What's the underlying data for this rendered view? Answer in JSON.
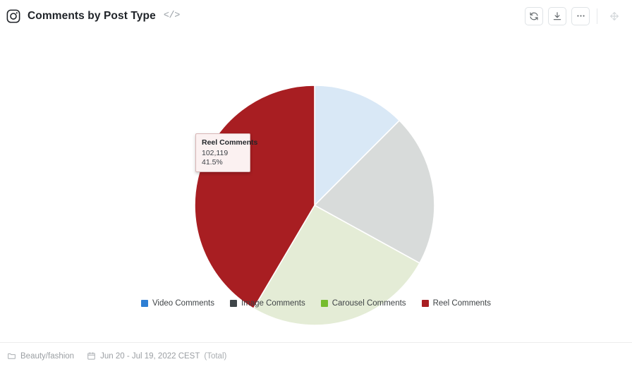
{
  "header": {
    "network_icon": "instagram-icon",
    "title": "Comments by Post Type",
    "code_icon_label": "</>",
    "actions": [
      {
        "name": "refresh-button",
        "icon": "refresh-icon"
      },
      {
        "name": "download-button",
        "icon": "download-icon"
      },
      {
        "name": "more-options-button",
        "icon": "ellipsis-icon"
      }
    ],
    "move_handle_icon": "move-arrows-icon"
  },
  "tooltip": {
    "title": "Reel Comments",
    "value": "102,119",
    "percent": "41.5%"
  },
  "footer": {
    "profile_icon": "folder-icon",
    "profile": "Beauty/fashion",
    "date_icon": "calendar-icon",
    "date_range": "Jun 20 - Jul 19, 2022 CEST",
    "aggregation": "(Total)"
  },
  "chart_data": {
    "type": "pie",
    "title": "Comments by Post Type",
    "categories": [
      "Video Comments",
      "Image Comments",
      "Carousel Comments",
      "Reel Comments"
    ],
    "values": [
      12.5,
      20.5,
      25.5,
      41.5
    ],
    "value_unit": "percent",
    "slice_colors": [
      "#d9e8f6",
      "#d8dbda",
      "#e4ecd6",
      "#a81e22"
    ],
    "legend_colors": [
      "#2e7fd4",
      "#3f4549",
      "#76bc2e",
      "#a81e22"
    ],
    "highlighted": "Reel Comments",
    "highlighted_value": "102,119",
    "highlighted_percent": "41.5%",
    "legend_position": "bottom",
    "grid": false,
    "start_angle_deg": 0,
    "direction": "clockwise"
  }
}
